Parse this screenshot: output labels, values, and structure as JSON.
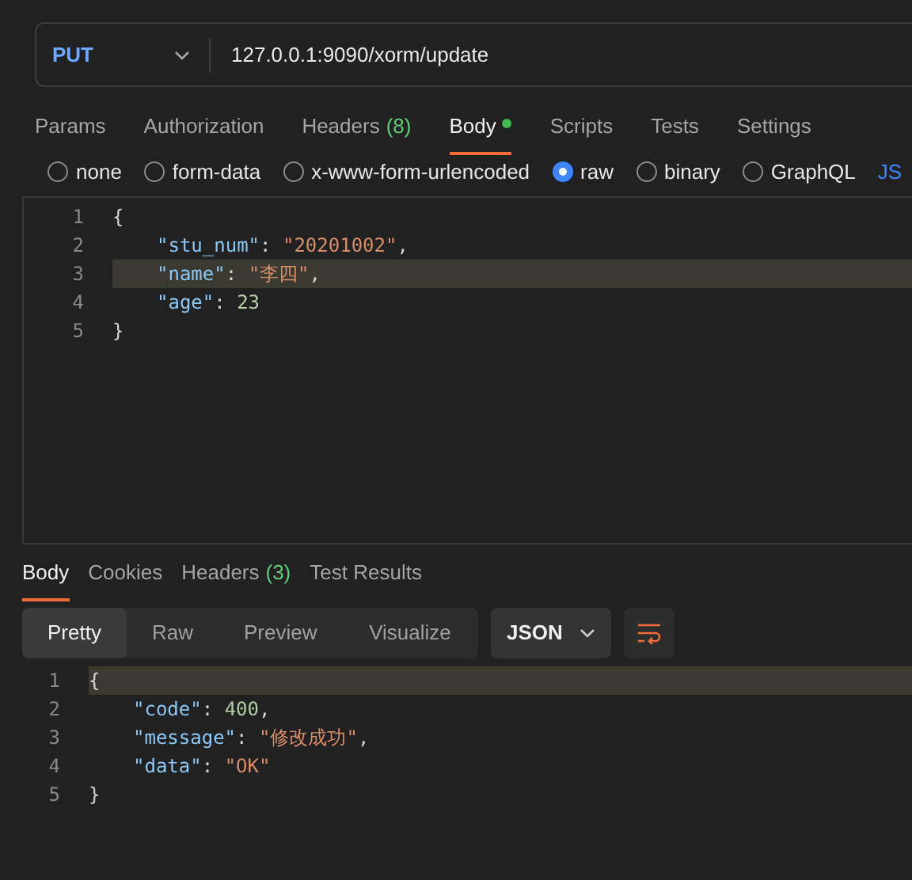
{
  "request": {
    "method": "PUT",
    "url": "127.0.0.1:9090/xorm/update"
  },
  "request_tabs": [
    {
      "label": "Params",
      "selected": false
    },
    {
      "label": "Authorization",
      "selected": false
    },
    {
      "label": "Headers",
      "count": "(8)",
      "selected": false
    },
    {
      "label": "Body",
      "dot": true,
      "selected": true
    },
    {
      "label": "Scripts",
      "selected": false
    },
    {
      "label": "Tests",
      "selected": false
    },
    {
      "label": "Settings",
      "selected": false
    }
  ],
  "body_types": [
    {
      "label": "none",
      "selected": false
    },
    {
      "label": "form-data",
      "selected": false
    },
    {
      "label": "x-www-form-urlencoded",
      "selected": false
    },
    {
      "label": "raw",
      "selected": true
    },
    {
      "label": "binary",
      "selected": false
    },
    {
      "label": "GraphQL",
      "selected": false
    }
  ],
  "body_format_cut": "JS",
  "request_editor": {
    "lines": [
      {
        "number": "1",
        "highlighted": false,
        "tokens": [
          {
            "kind": "punct",
            "text": "{"
          }
        ]
      },
      {
        "number": "2",
        "highlighted": false,
        "tokens": [
          {
            "kind": "key",
            "text": "\"stu_num\""
          },
          {
            "kind": "punct",
            "text": ": "
          },
          {
            "kind": "string",
            "text": "\"20201002\""
          },
          {
            "kind": "punct",
            "text": ","
          }
        ]
      },
      {
        "number": "3",
        "highlighted": true,
        "tokens": [
          {
            "kind": "key",
            "text": "\"name\""
          },
          {
            "kind": "punct",
            "text": ": "
          },
          {
            "kind": "string",
            "text": "\"李四\""
          },
          {
            "kind": "punct",
            "text": ","
          }
        ]
      },
      {
        "number": "4",
        "highlighted": false,
        "tokens": [
          {
            "kind": "key",
            "text": "\"age\""
          },
          {
            "kind": "punct",
            "text": ": "
          },
          {
            "kind": "number",
            "text": "23"
          }
        ]
      },
      {
        "number": "5",
        "highlighted": false,
        "tokens": [
          {
            "kind": "punct",
            "text": "}"
          }
        ]
      }
    ]
  },
  "response_tabs": [
    {
      "label": "Body",
      "selected": true
    },
    {
      "label": "Cookies",
      "selected": false
    },
    {
      "label": "Headers",
      "count": "(3)",
      "selected": false
    },
    {
      "label": "Test Results",
      "selected": false
    }
  ],
  "view_modes": [
    {
      "label": "Pretty",
      "selected": true
    },
    {
      "label": "Raw",
      "selected": false
    },
    {
      "label": "Preview",
      "selected": false
    },
    {
      "label": "Visualize",
      "selected": false
    }
  ],
  "format": "JSON",
  "response_editor": {
    "lines": [
      {
        "number": "1",
        "highlighted": true,
        "tokens": [
          {
            "kind": "punct",
            "text": "{"
          }
        ]
      },
      {
        "number": "2",
        "highlighted": false,
        "tokens": [
          {
            "kind": "key",
            "text": "\"code\""
          },
          {
            "kind": "punct",
            "text": ": "
          },
          {
            "kind": "number",
            "text": "400"
          },
          {
            "kind": "punct",
            "text": ","
          }
        ]
      },
      {
        "number": "3",
        "highlighted": false,
        "tokens": [
          {
            "kind": "key",
            "text": "\"message\""
          },
          {
            "kind": "punct",
            "text": ": "
          },
          {
            "kind": "string",
            "text": "\"修改成功\""
          },
          {
            "kind": "punct",
            "text": ","
          }
        ]
      },
      {
        "number": "4",
        "highlighted": false,
        "tokens": [
          {
            "kind": "key",
            "text": "\"data\""
          },
          {
            "kind": "punct",
            "text": ": "
          },
          {
            "kind": "string",
            "text": "\"OK\""
          }
        ]
      },
      {
        "number": "5",
        "highlighted": false,
        "tokens": [
          {
            "kind": "punct",
            "text": "}"
          }
        ]
      }
    ]
  }
}
